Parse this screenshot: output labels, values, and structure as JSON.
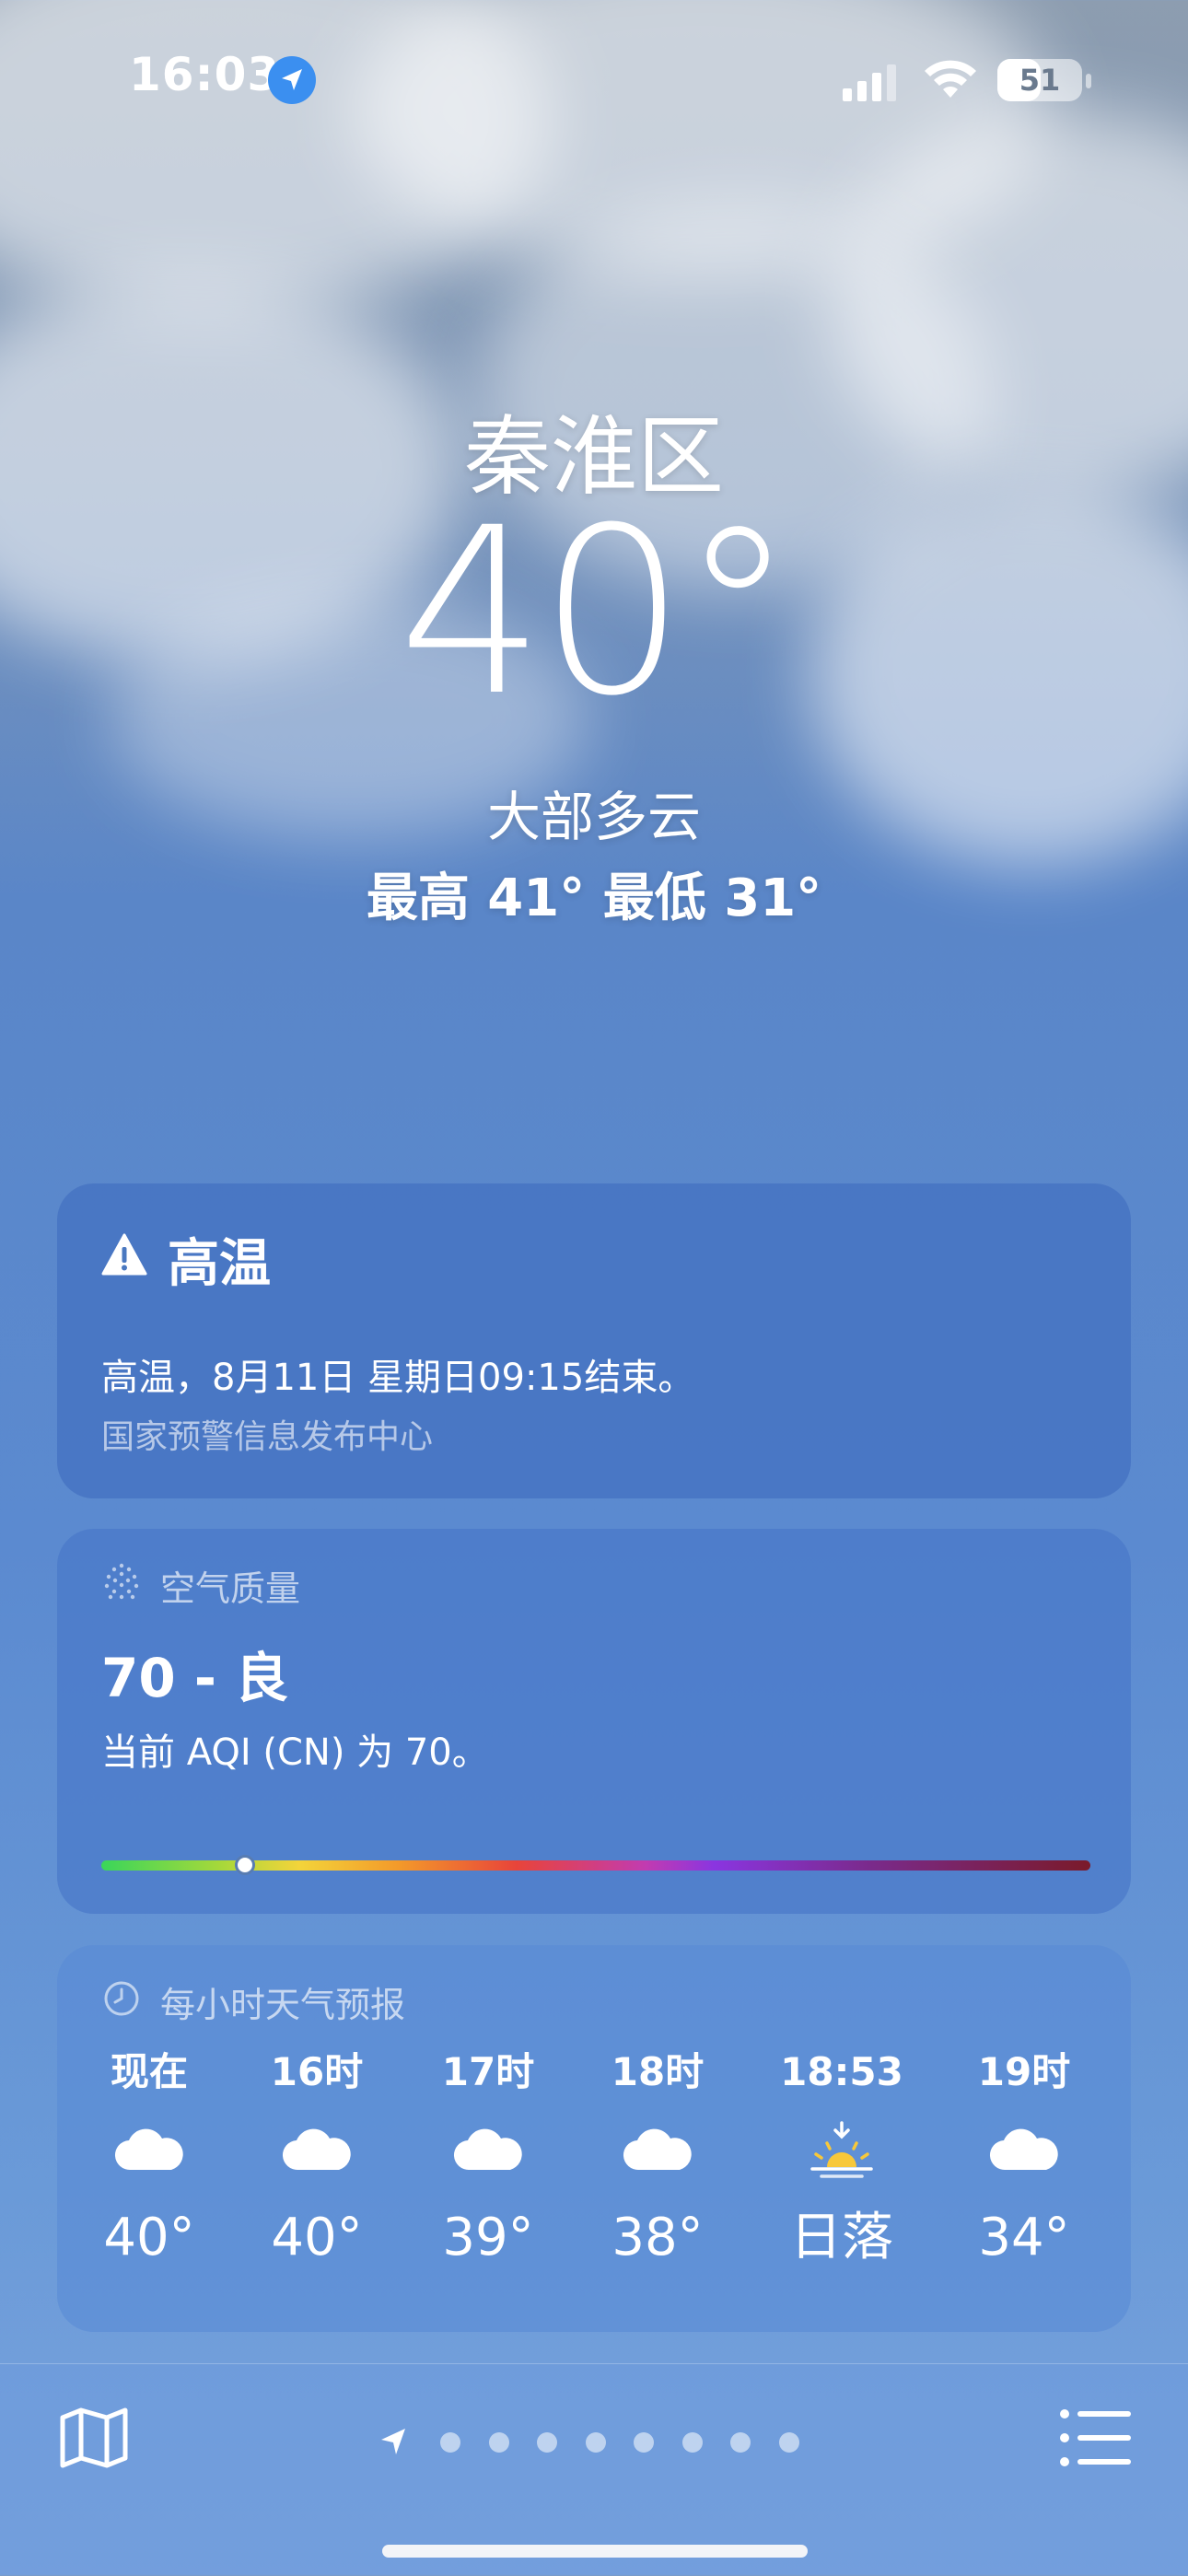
{
  "status_bar": {
    "time": "16:03",
    "battery": "51",
    "battery_level": 0.51,
    "icons": [
      "location-arrow-icon",
      "cellular-signal-icon",
      "wifi-icon",
      "battery-icon"
    ]
  },
  "current": {
    "location": "秦淮区",
    "temperature": "40°",
    "condition": "大部多云",
    "high_low": "最高 41°  最低 31°"
  },
  "alert_card": {
    "icon": "warning-icon",
    "title": "高温",
    "description": "高温，8月11日 星期日09:15结束。",
    "source": "国家预警信息发布中心"
  },
  "air_quality_card": {
    "icon": "air-quality-icon",
    "title": "空气质量",
    "value": "70 - 良",
    "description": "当前 AQI (CN) 为 70。",
    "scale_position": 0.145
  },
  "hourly_card": {
    "icon": "clock-icon",
    "title": "每小时天气预报",
    "hours": [
      {
        "label": "现在",
        "icon": "cloud-icon",
        "temp": "40°"
      },
      {
        "label": "16时",
        "icon": "cloud-icon",
        "temp": "40°"
      },
      {
        "label": "17时",
        "icon": "cloud-icon",
        "temp": "39°"
      },
      {
        "label": "18时",
        "icon": "cloud-icon",
        "temp": "38°"
      },
      {
        "label": "18:53",
        "icon": "sunset-icon",
        "temp": "日落"
      },
      {
        "label": "19时",
        "icon": "cloud-icon",
        "temp": "34°"
      }
    ]
  },
  "bottom_bar": {
    "left_icon": "map-icon",
    "right_icon": "list-icon",
    "page_count": 8,
    "current_page_icon": "location-arrow-icon"
  },
  "colors": {
    "sunset": "#f7c83a",
    "card_bg": "#4f7fc6"
  }
}
